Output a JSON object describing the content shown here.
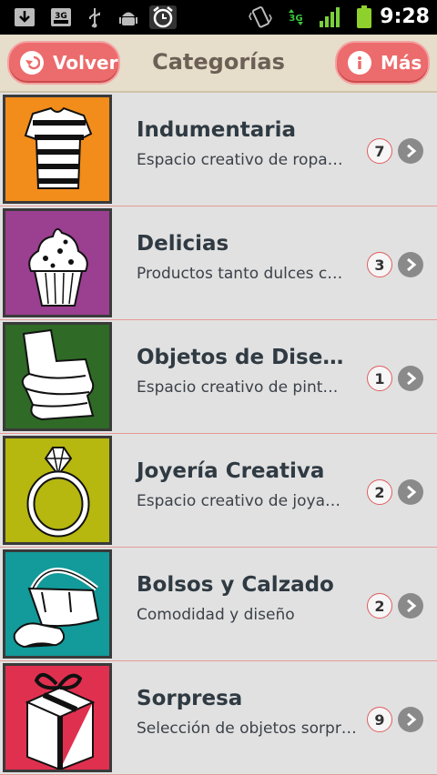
{
  "status": {
    "time": "9:28",
    "network": "3G",
    "sim_label": "3G"
  },
  "header": {
    "back_label": "Volver",
    "title": "Categorías",
    "more_label": "Más"
  },
  "items": [
    {
      "title": "Indumentaria",
      "desc": "Espacio creativo de ropa…",
      "count": "7",
      "color": "#f28c1a",
      "icon": "shirt-icon"
    },
    {
      "title": "Delicias",
      "desc": "Productos tanto dulces c…",
      "count": "3",
      "color": "#9b3f91",
      "icon": "cupcake-icon"
    },
    {
      "title": "Objetos de Dise…",
      "desc": "Espacio creativo de pint…",
      "count": "1",
      "color": "#2f6a26",
      "icon": "chair-icon"
    },
    {
      "title": "Joyería Creativa",
      "desc": "Espacio creativo de joya…",
      "count": "2",
      "color": "#b6b70f",
      "icon": "ring-icon"
    },
    {
      "title": "Bolsos y Calzado",
      "desc": "Comodidad y diseño",
      "count": "2",
      "color": "#139a9a",
      "icon": "bag-icon"
    },
    {
      "title": "Sorpresa",
      "desc": "Selección de objetos sorpr…",
      "count": "9",
      "color": "#e0304f",
      "icon": "gift-icon"
    }
  ]
}
